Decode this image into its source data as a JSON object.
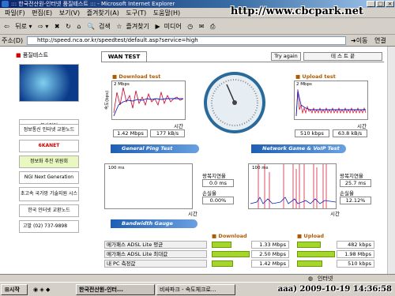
{
  "window": {
    "title": "::: 한국전산원-인터넷 품질테스트 ::: - Microsoft Internet Explorer",
    "min": "_",
    "max": "□",
    "close": "×"
  },
  "menu": {
    "items": [
      "파일(F)",
      "편집(E)",
      "보기(V)",
      "즐겨찾기(A)",
      "도구(T)",
      "도움말(H)"
    ]
  },
  "watermark": "http://www.cbcpark.net",
  "toolbar": {
    "back": "뒤로",
    "search": "검색",
    "favorites": "즐겨찾기",
    "media": "미디어"
  },
  "address": {
    "label": "주소(D)",
    "url": "http://speed.nca.or.kr/speedtest/default.asp?service=high",
    "go": "이동",
    "links": "연결"
  },
  "sidebar": {
    "title": "품질테스트",
    "items": [
      "부산인터",
      "정보통신 인터넷 교환노드",
      "6KANET",
      "정보화 추진 위원회",
      "NGI Next Generation",
      "초고속 국가망 기술지원 시스템",
      "한국 인터넷 교환노드",
      "고발 (02) 737-9898"
    ]
  },
  "wan": {
    "tab": "WAN TEST",
    "try_again": "Try again",
    "test_end": "테 스 트 끝"
  },
  "download": {
    "title": "Download test",
    "scale": "2 Mbps",
    "ylabel": "속도(bps)",
    "xlabel": "시간",
    "mbps": "1.42 Mbps",
    "kbs": "177 kB/s"
  },
  "upload": {
    "title": "Upload test",
    "scale": "2 Mbps",
    "ylabel": "속도(bps)",
    "xlabel": "시간",
    "kbps": "510 kbps",
    "kbs": "63.8 kB/s"
  },
  "ping": {
    "header": "General Ping Test",
    "scale": "100 ms",
    "xlabel": "시간",
    "rtt_label": "왕복지연율",
    "rtt": "0.0 ms",
    "loss_label": "손실율",
    "loss": "0.00%"
  },
  "game": {
    "header": "Network Game & VoIP Test",
    "scale": "100 ms",
    "xlabel": "시간",
    "rtt_label": "왕복지연율",
    "rtt": "25.7 ms",
    "loss_label": "손실율",
    "loss": "12.12%"
  },
  "gauge_header": "Bandwidth Gauge",
  "bandwidth": {
    "download_label": "Download",
    "upload_label": "Upload",
    "rows": [
      {
        "label": "메가패스 ADSL Lite 평균",
        "down": "1.33 Mbps",
        "up": "482 kbps",
        "down_frac": 0.53,
        "up_frac": 0.63
      },
      {
        "label": "메가패스 ADSL Lite 최대값",
        "down": "2.50 Mbps",
        "up": "1.98 Mbps",
        "down_frac": 1.0,
        "up_frac": 1.0
      },
      {
        "label": "내 PC 측정값",
        "down": "1.42 Mbps",
        "up": "510 kbps",
        "down_frac": 0.57,
        "up_frac": 0.66
      }
    ]
  },
  "status": {
    "zone": "인터넷"
  },
  "taskbar": {
    "start": "시작",
    "tasks": [
      "한국전산원-인터...",
      "비싸파크 - 속도체크로..."
    ],
    "clock": "aaa) 2009-10-19 14:36:58"
  }
}
